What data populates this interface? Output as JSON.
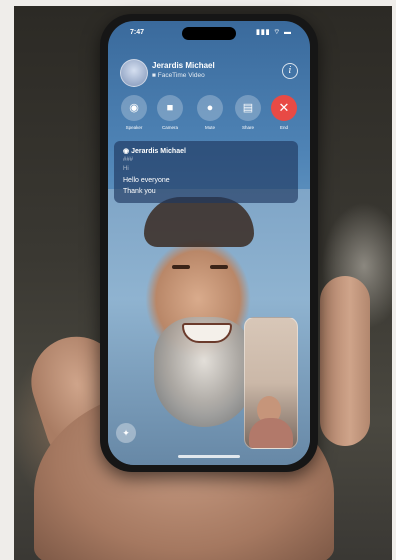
{
  "status_bar": {
    "time": "7:47",
    "icons": "▮▮▮ ⌔ ▬"
  },
  "call": {
    "caller_name": "Jerardis Michael",
    "subtitle": "FaceTime Video",
    "info_icon": "i"
  },
  "controls": [
    {
      "icon": "speaker-icon",
      "glyph": "◉",
      "label": "Speaker"
    },
    {
      "icon": "camera-icon",
      "glyph": "■",
      "label": "Camera"
    },
    {
      "icon": "mic-icon",
      "glyph": "●",
      "label": "Mute"
    },
    {
      "icon": "share-icon",
      "glyph": "▤",
      "label": "Share"
    },
    {
      "icon": "end-call-icon",
      "glyph": "✕",
      "label": "End"
    }
  ],
  "captions": {
    "speaker": "Jerardis Michael",
    "line_1": "###",
    "line_2": "Hi",
    "line_3": "Hello everyone",
    "line_4": "Thank you"
  },
  "effects_icon": "✦",
  "colors": {
    "end_call": "#e84a45",
    "caption_bg": "#1e375f"
  }
}
